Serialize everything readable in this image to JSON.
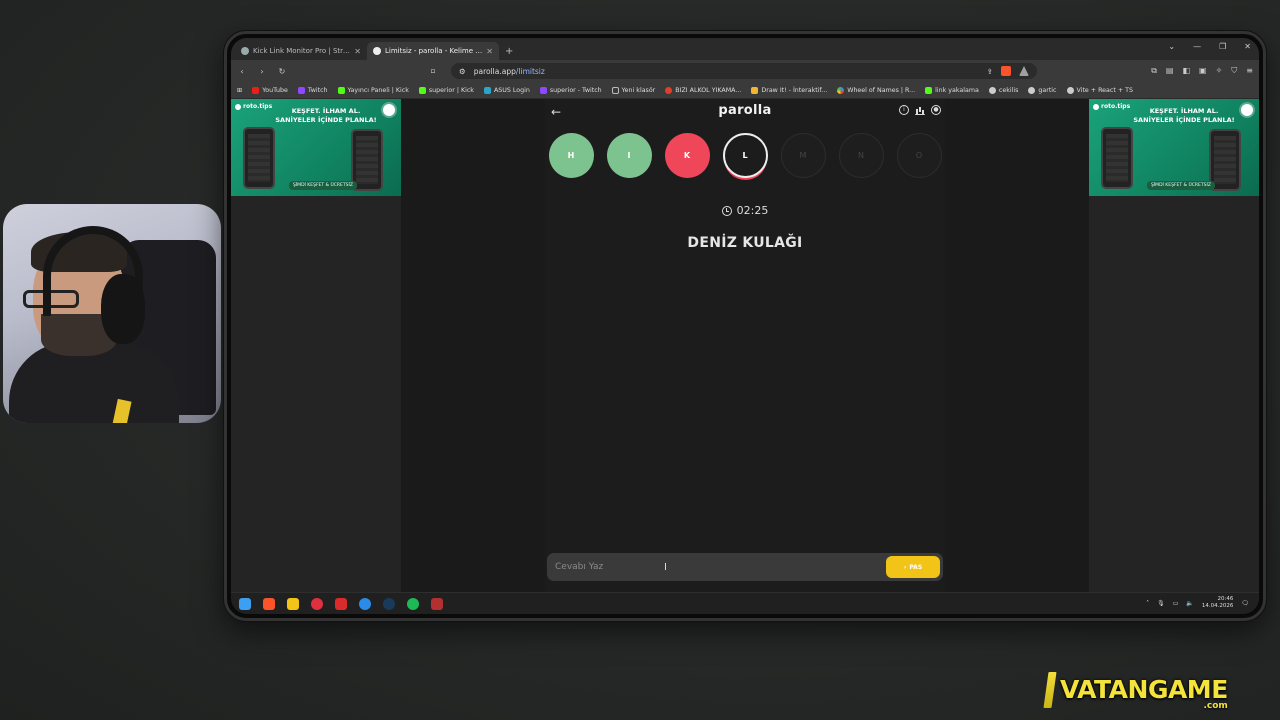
{
  "browser": {
    "tabs": [
      {
        "title": "Kick Link Monitor Pro | Stream Deck",
        "active": false
      },
      {
        "title": "Limitsiz - parolla - Kelime oyunu",
        "active": true
      }
    ],
    "url_host": "parolla.app",
    "url_path": "/limitsiz",
    "bookmarks": [
      {
        "label": "YouTube",
        "color": "#e62117"
      },
      {
        "label": "Twitch",
        "color": "#9146ff"
      },
      {
        "label": "Yayıncı Paneli | Kick",
        "color": "#53fc18"
      },
      {
        "label": "superior | Kick",
        "color": "#53fc18"
      },
      {
        "label": "ASUS Login",
        "color": "#2aa6c9"
      },
      {
        "label": "superior - Twitch",
        "color": "#9146ff"
      },
      {
        "label": "Yeni klasör",
        "color": "#bbbbbb"
      },
      {
        "label": "BIZI ALKOL YIKAMA...",
        "color": "#e0402a"
      },
      {
        "label": "Draw It! - İnteraktif...",
        "color": "#f2b632"
      },
      {
        "label": "Wheel of Names | R...",
        "color": "#3a8ee6"
      },
      {
        "label": "link yakalama",
        "color": "#53fc18"
      },
      {
        "label": "cekilis",
        "color": "#cccccc"
      },
      {
        "label": "gartic",
        "color": "#cccccc"
      },
      {
        "label": "Vite + React + TS",
        "color": "#cccccc"
      }
    ]
  },
  "ads": {
    "brand": "roto.tips",
    "headline_1": "KEŞFET. İLHAM AL.",
    "headline_2": "SANİYELER İÇİNDE PLANLA!",
    "cta": "ŞİMDİ KEŞFET & ÜCRETSİZ"
  },
  "game": {
    "title": "parolla",
    "letters": [
      {
        "char": "H",
        "state": "correct"
      },
      {
        "char": "I",
        "state": "correct"
      },
      {
        "char": "K",
        "state": "wrong"
      },
      {
        "char": "L",
        "state": "current"
      },
      {
        "char": "M",
        "state": "pending"
      },
      {
        "char": "N",
        "state": "pending"
      },
      {
        "char": "O",
        "state": "pending"
      }
    ],
    "timer": "02:25",
    "question": "DENİZ KULAĞI",
    "answer_placeholder": "Cevabı Yaz",
    "pass_label": "PAS",
    "colors": {
      "correct": "#7cc38f",
      "wrong": "#f0465a",
      "pass": "#f2c417"
    }
  },
  "taskbar": {
    "time": "20:46",
    "date": "14.04.2026"
  },
  "watermark": {
    "text": "VATANGAME",
    "sub": ".com"
  }
}
